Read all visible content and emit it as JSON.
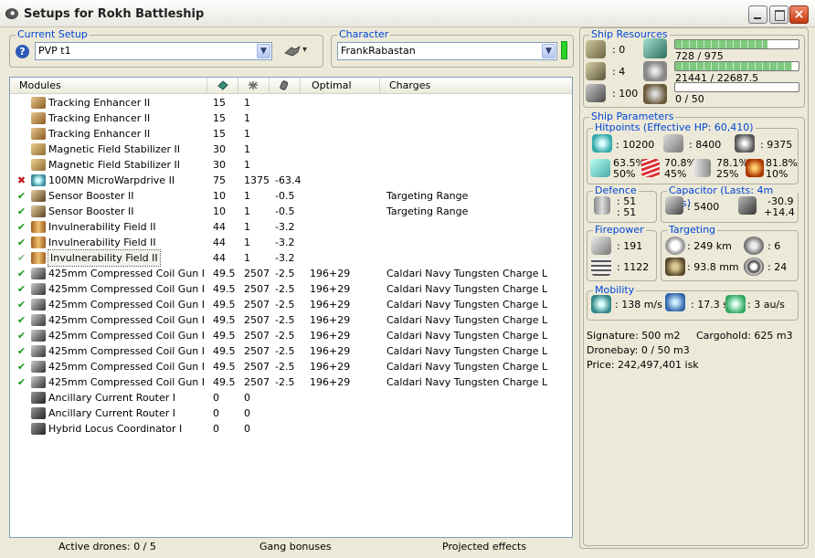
{
  "window": {
    "title": "Setups for Rokh Battleship",
    "close": "×"
  },
  "setup": {
    "label": "Current Setup",
    "value": "PVP t1",
    "help": "?",
    "tool_caret": "▾"
  },
  "character": {
    "label": "Character",
    "value": "FrankRabastan",
    "status_color": "#26d426"
  },
  "modules_list": {
    "headers": {
      "name": "Modules",
      "optimal": "Optimal",
      "charges": "Charges"
    },
    "header_icons": [
      "cpu-icon",
      "powergrid-icon",
      "capacitor-icon"
    ],
    "rows": [
      {
        "status": "",
        "name": "Tracking Enhancer II",
        "cpu": "15",
        "pg": "1",
        "cap": "",
        "optimal": "",
        "charges": "",
        "icon": "tracking-enhancer-icon"
      },
      {
        "status": "",
        "name": "Tracking Enhancer II",
        "cpu": "15",
        "pg": "1",
        "cap": "",
        "optimal": "",
        "charges": "",
        "icon": "tracking-enhancer-icon"
      },
      {
        "status": "",
        "name": "Tracking Enhancer II",
        "cpu": "15",
        "pg": "1",
        "cap": "",
        "optimal": "",
        "charges": "",
        "icon": "tracking-enhancer-icon"
      },
      {
        "status": "",
        "name": "Magnetic Field Stabilizer II",
        "cpu": "30",
        "pg": "1",
        "cap": "",
        "optimal": "",
        "charges": "",
        "icon": "magnetic-stabilizer-icon"
      },
      {
        "status": "",
        "name": "Magnetic Field Stabilizer II",
        "cpu": "30",
        "pg": "1",
        "cap": "",
        "optimal": "",
        "charges": "",
        "icon": "magnetic-stabilizer-icon"
      },
      {
        "status": "✖",
        "name": "100MN MicroWarpdrive II",
        "cpu": "75",
        "pg": "1375",
        "cap": "-63.4",
        "optimal": "",
        "charges": "",
        "icon": "microwarpdrive-icon"
      },
      {
        "status": "✔",
        "name": "Sensor Booster II",
        "cpu": "10",
        "pg": "1",
        "cap": "-0.5",
        "optimal": "",
        "charges": "Targeting Range",
        "icon": "sensor-booster-icon"
      },
      {
        "status": "✔",
        "name": "Sensor Booster II",
        "cpu": "10",
        "pg": "1",
        "cap": "-0.5",
        "optimal": "",
        "charges": "Targeting Range",
        "icon": "sensor-booster-icon"
      },
      {
        "status": "✔",
        "name": "Invulnerability Field II",
        "cpu": "44",
        "pg": "1",
        "cap": "-3.2",
        "optimal": "",
        "charges": "",
        "icon": "invulnerability-field-icon"
      },
      {
        "status": "✔",
        "name": "Invulnerability Field II",
        "cpu": "44",
        "pg": "1",
        "cap": "-3.2",
        "optimal": "",
        "charges": "",
        "icon": "invulnerability-field-icon"
      },
      {
        "status": "✔",
        "name": "Invulnerability Field II",
        "cpu": "44",
        "pg": "1",
        "cap": "-3.2",
        "optimal": "",
        "charges": "",
        "icon": "invulnerability-field-icon"
      },
      {
        "status": "✔",
        "name": "425mm Compressed Coil Gun I",
        "cpu": "49.5",
        "pg": "2507",
        "cap": "-2.5",
        "optimal": "196+29",
        "charges": "Caldari Navy Tungsten Charge L",
        "icon": "railgun-icon"
      },
      {
        "status": "✔",
        "name": "425mm Compressed Coil Gun I",
        "cpu": "49.5",
        "pg": "2507",
        "cap": "-2.5",
        "optimal": "196+29",
        "charges": "Caldari Navy Tungsten Charge L",
        "icon": "railgun-icon"
      },
      {
        "status": "✔",
        "name": "425mm Compressed Coil Gun I",
        "cpu": "49.5",
        "pg": "2507",
        "cap": "-2.5",
        "optimal": "196+29",
        "charges": "Caldari Navy Tungsten Charge L",
        "icon": "railgun-icon"
      },
      {
        "status": "✔",
        "name": "425mm Compressed Coil Gun I",
        "cpu": "49.5",
        "pg": "2507",
        "cap": "-2.5",
        "optimal": "196+29",
        "charges": "Caldari Navy Tungsten Charge L",
        "icon": "railgun-icon"
      },
      {
        "status": "✔",
        "name": "425mm Compressed Coil Gun I",
        "cpu": "49.5",
        "pg": "2507",
        "cap": "-2.5",
        "optimal": "196+29",
        "charges": "Caldari Navy Tungsten Charge L",
        "icon": "railgun-icon"
      },
      {
        "status": "✔",
        "name": "425mm Compressed Coil Gun I",
        "cpu": "49.5",
        "pg": "2507",
        "cap": "-2.5",
        "optimal": "196+29",
        "charges": "Caldari Navy Tungsten Charge L",
        "icon": "railgun-icon"
      },
      {
        "status": "✔",
        "name": "425mm Compressed Coil Gun I",
        "cpu": "49.5",
        "pg": "2507",
        "cap": "-2.5",
        "optimal": "196+29",
        "charges": "Caldari Navy Tungsten Charge L",
        "icon": "railgun-icon"
      },
      {
        "status": "✔",
        "name": "425mm Compressed Coil Gun I",
        "cpu": "49.5",
        "pg": "2507",
        "cap": "-2.5",
        "optimal": "196+29",
        "charges": "Caldari Navy Tungsten Charge L",
        "icon": "railgun-icon"
      },
      {
        "status": "",
        "name": "Ancillary Current Router I",
        "cpu": "0",
        "pg": "0",
        "cap": "",
        "optimal": "",
        "charges": "",
        "icon": "rig-icon"
      },
      {
        "status": "",
        "name": "Ancillary Current Router I",
        "cpu": "0",
        "pg": "0",
        "cap": "",
        "optimal": "",
        "charges": "",
        "icon": "rig-icon"
      },
      {
        "status": "",
        "name": "Hybrid Locus Coordinator I",
        "cpu": "0",
        "pg": "0",
        "cap": "",
        "optimal": "",
        "charges": "",
        "icon": "rig-icon"
      }
    ]
  },
  "status_bar": {
    "drones": "Active drones: 0 / 5",
    "gang": "Gang bonuses",
    "projected": "Projected effects"
  },
  "resources": {
    "label": "Ship Resources",
    "turrets": ": 0",
    "launchers": ": 4",
    "calibration": ": 100",
    "cpu": {
      "text": "728 / 975",
      "fraction": 0.747
    },
    "powergrid": {
      "text": "21441 / 22687.5",
      "fraction": 0.945
    },
    "drone_bandwidth": {
      "text": "0 / 50",
      "fraction": 0
    }
  },
  "parameters": {
    "label": "Ship Parameters",
    "hitpoints": {
      "label": "Hitpoints (Effective HP: 60,410)",
      "shield": ": 10200",
      "armor": ": 8400",
      "structure": ": 9375",
      "resists": [
        {
          "top": "63.5%",
          "bottom": "50%"
        },
        {
          "top": "70.8%",
          "bottom": "45%"
        },
        {
          "top": "78.1%",
          "bottom": "25%"
        },
        {
          "top": "81.8%",
          "bottom": "10%"
        }
      ]
    },
    "defence": {
      "label": "Defence",
      "top": ": 51",
      "bottom": ": 51"
    },
    "capacitor": {
      "label": "Capacitor (Lasts: 4m 24s)",
      "capacity": ": 5400",
      "rate_top": "-30.9",
      "rate_bottom": "+14.4"
    },
    "firepower": {
      "label": "Firepower",
      "top": ": 191",
      "bottom": ": 1122"
    },
    "targeting": {
      "label": "Targeting",
      "range": ": 249 km",
      "scan": ": 93.8 mm",
      "targets": ": 6",
      "sensor": ": 24"
    },
    "mobility": {
      "label": "Mobility",
      "speed": ": 138 m/s",
      "align": ": 17.3 s",
      "warp": ": 3 au/s"
    },
    "signature": "Signature: 500 m2",
    "cargohold": "Cargohold: 625 m3",
    "dronebay": "Dronebay: 0 / 50 m3",
    "price": "Price: 242,497,401 isk"
  }
}
